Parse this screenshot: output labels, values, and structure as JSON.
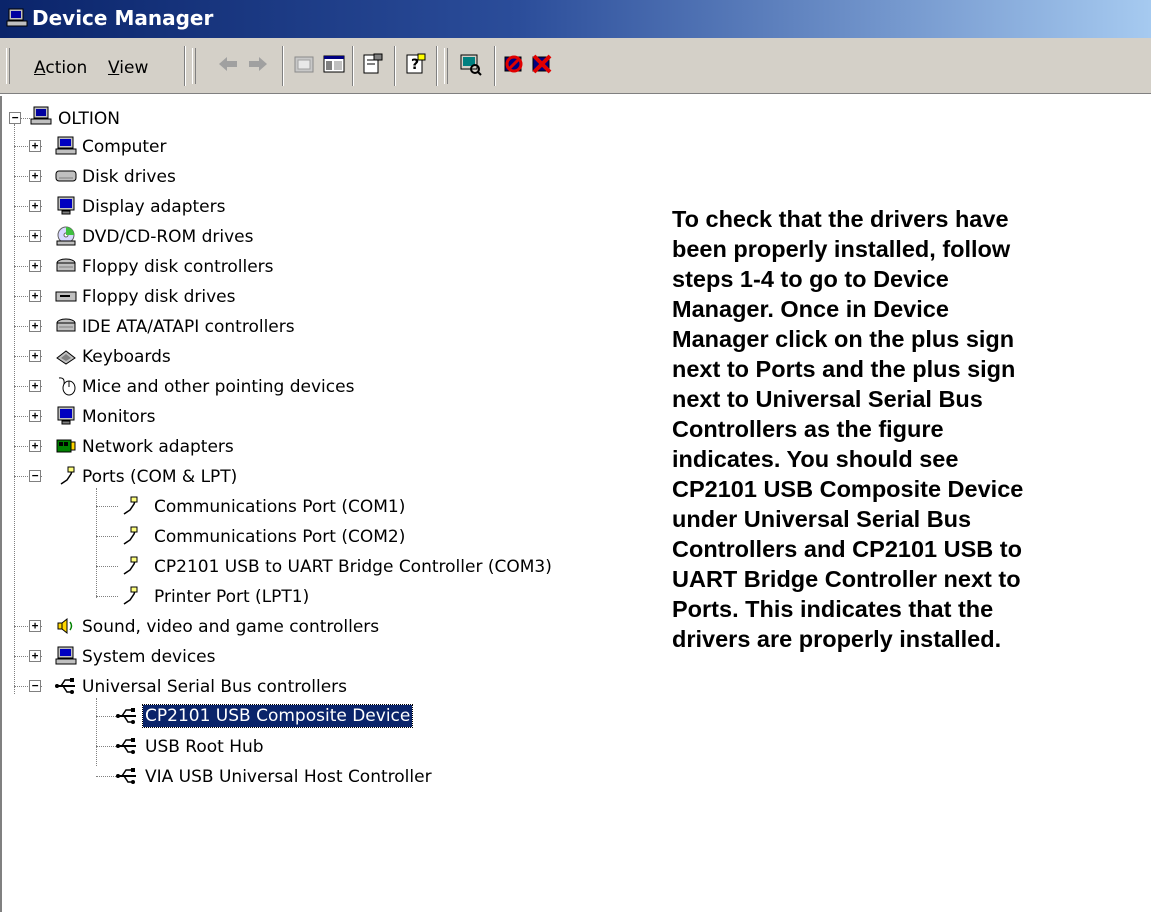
{
  "window": {
    "title": "Device Manager",
    "icon": "device-manager-icon"
  },
  "menu": {
    "action": "Action",
    "view": "View"
  },
  "toolbar": {
    "buttons": [
      {
        "name": "back-icon"
      },
      {
        "name": "forward-icon"
      },
      {
        "name": "up-icon"
      },
      {
        "name": "show-hide-tree-icon"
      },
      {
        "name": "properties-icon"
      },
      {
        "name": "help-icon"
      },
      {
        "name": "scan-hardware-icon"
      },
      {
        "name": "disable-device-icon"
      },
      {
        "name": "uninstall-device-icon"
      }
    ]
  },
  "tree": {
    "root": "OLTION",
    "categories": [
      {
        "label": "Computer",
        "icon": "computer-icon"
      },
      {
        "label": "Disk drives",
        "icon": "disk-drive-icon"
      },
      {
        "label": "Display adapters",
        "icon": "display-adapter-icon"
      },
      {
        "label": "DVD/CD-ROM drives",
        "icon": "dvd-drive-icon"
      },
      {
        "label": "Floppy disk controllers",
        "icon": "floppy-controller-icon"
      },
      {
        "label": "Floppy disk drives",
        "icon": "floppy-drive-icon"
      },
      {
        "label": "IDE ATA/ATAPI controllers",
        "icon": "ide-controller-icon"
      },
      {
        "label": "Keyboards",
        "icon": "keyboard-icon"
      },
      {
        "label": "Mice and other pointing devices",
        "icon": "mouse-icon"
      },
      {
        "label": "Monitors",
        "icon": "monitor-icon"
      },
      {
        "label": "Network adapters",
        "icon": "network-adapter-icon"
      },
      {
        "label": "Ports (COM & LPT)",
        "icon": "port-icon"
      },
      {
        "label": "Communications Port (COM1)",
        "icon": "port-icon"
      },
      {
        "label": "Communications Port (COM2)",
        "icon": "port-icon"
      },
      {
        "label": "CP2101 USB to UART Bridge Controller (COM3)",
        "icon": "port-icon"
      },
      {
        "label": "Printer Port (LPT1)",
        "icon": "port-icon"
      },
      {
        "label": "Sound, video and game controllers",
        "icon": "sound-icon"
      },
      {
        "label": "System devices",
        "icon": "system-devices-icon"
      },
      {
        "label": "Universal Serial Bus controllers",
        "icon": "usb-icon"
      },
      {
        "label": "CP2101 USB Composite Device",
        "icon": "usb-icon"
      },
      {
        "label": "USB Root Hub",
        "icon": "usb-icon"
      },
      {
        "label": "VIA USB Universal Host Controller",
        "icon": "usb-icon"
      }
    ],
    "selected": "CP2101 USB Composite Device"
  },
  "instructions": {
    "lines": [
      "To check that the drivers have",
      "been properly installed, follow",
      "steps 1-4 to go to Device",
      "Manager. Once in Device",
      "Manager click on the plus sign",
      "next to Ports and the plus sign",
      "next to Universal Serial Bus",
      "Controllers as the figure",
      "indicates. You should see",
      "CP2101 USB Composite Device",
      "under Universal Serial Bus",
      "Controllers and CP2101 USB to",
      "UART Bridge Controller next to",
      "Ports. This indicates that the",
      "drivers are properly installed."
    ]
  },
  "colors": {
    "titlebar_start": "#0a246a",
    "titlebar_end": "#a6caf0",
    "toolbar_bg": "#d4d0c8",
    "selection": "#0a246a"
  }
}
